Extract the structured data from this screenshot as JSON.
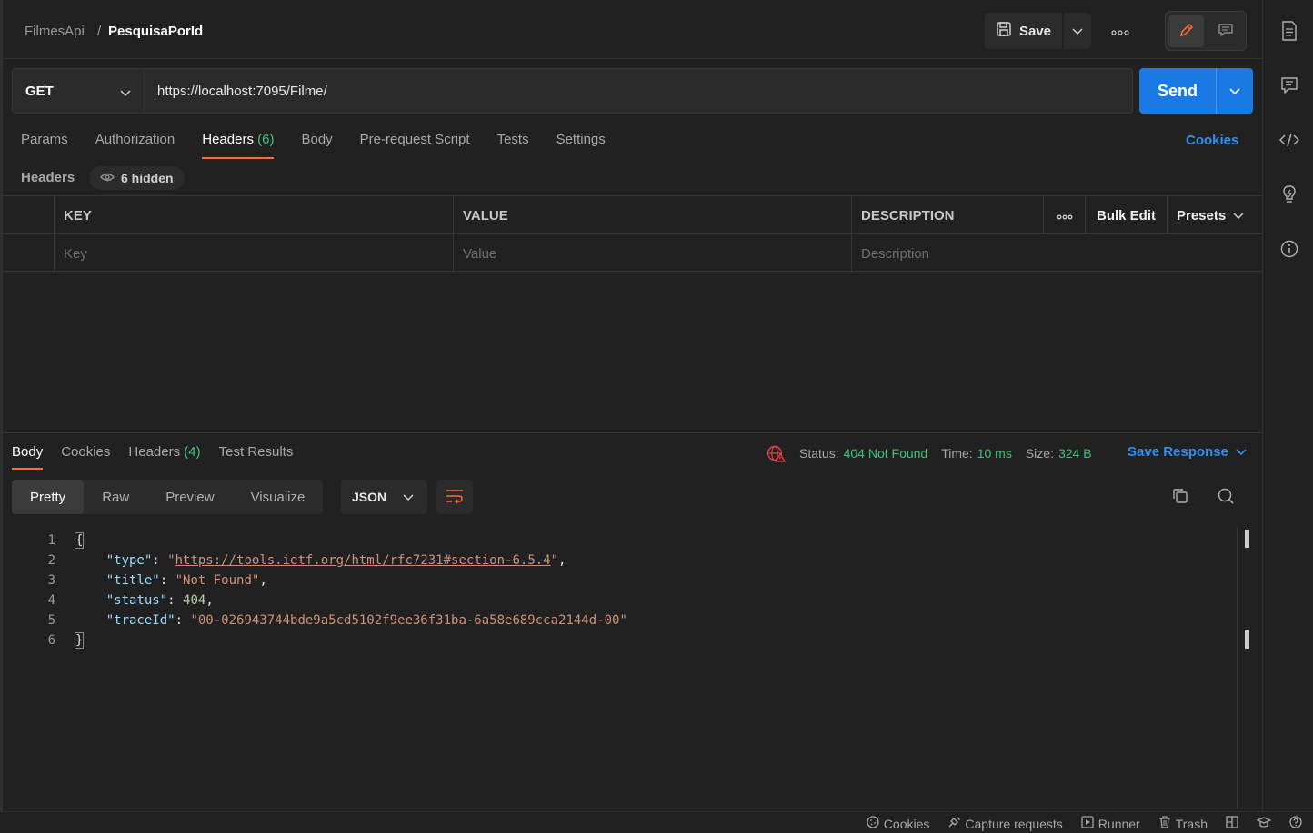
{
  "header": {
    "collection": "FilmesApi",
    "separator": "/",
    "request_name": "PesquisaPorId",
    "save_label": "Save"
  },
  "request": {
    "method": "GET",
    "url": "https://localhost:7095/Filme/",
    "send_label": "Send"
  },
  "request_tabs": [
    {
      "label": "Params"
    },
    {
      "label": "Authorization"
    },
    {
      "label": "Headers",
      "count": "(6)"
    },
    {
      "label": "Body"
    },
    {
      "label": "Pre-request Script"
    },
    {
      "label": "Tests"
    },
    {
      "label": "Settings"
    }
  ],
  "cookies_link": "Cookies",
  "headers_section": {
    "title": "Headers",
    "hidden_label": "6 hidden",
    "columns": {
      "key": "KEY",
      "value": "VALUE",
      "description": "DESCRIPTION"
    },
    "bulk_edit": "Bulk Edit",
    "presets": "Presets",
    "placeholders": {
      "key": "Key",
      "value": "Value",
      "description": "Description"
    }
  },
  "response": {
    "tabs": [
      {
        "label": "Body"
      },
      {
        "label": "Cookies"
      },
      {
        "label": "Headers",
        "count": "(4)"
      },
      {
        "label": "Test Results"
      }
    ],
    "status_label": "Status:",
    "status_value": "404 Not Found",
    "time_label": "Time:",
    "time_value": "10 ms",
    "size_label": "Size:",
    "size_value": "324 B",
    "save_response": "Save Response",
    "view_modes": [
      "Pretty",
      "Raw",
      "Preview",
      "Visualize"
    ],
    "format": "JSON",
    "code_lines": [
      {
        "num": "1",
        "text": "{"
      },
      {
        "num": "2",
        "key": "\"type\"",
        "value": "\"https://tools.ietf.org/html/rfc7231#section-6.5.4\"",
        "url": "https://tools.ietf.org/html/rfc7231#section-6.5.4"
      },
      {
        "num": "3",
        "key": "\"title\"",
        "value": "\"Not Found\""
      },
      {
        "num": "4",
        "key": "\"status\"",
        "value": "404"
      },
      {
        "num": "5",
        "key": "\"traceId\"",
        "value": "\"00-026943744bde9a5cd5102f9ee36f31ba-6a58e689cca2144d-00\""
      },
      {
        "num": "6",
        "text": "}"
      }
    ]
  },
  "statusbar": {
    "cookies": "Cookies",
    "capture": "Capture requests",
    "runner": "Runner",
    "trash": "Trash"
  },
  "colors": {
    "accent_orange": "#ff6c37",
    "send_blue": "#1a7ae3",
    "link_blue": "#2f8ef0",
    "success_green": "#3cc57a"
  }
}
